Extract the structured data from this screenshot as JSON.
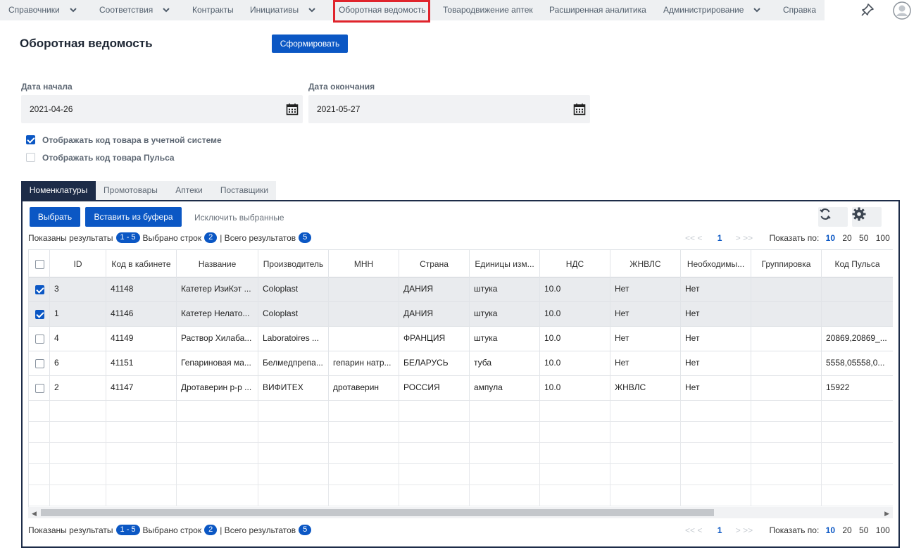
{
  "nav": {
    "items": [
      {
        "label": "Справочники",
        "dropdown": true
      },
      {
        "label": "Соответствия",
        "dropdown": true
      },
      {
        "label": "Контракты",
        "dropdown": false
      },
      {
        "label": "Инициативы",
        "dropdown": true
      },
      {
        "label": "Оборотная ведомость",
        "dropdown": false,
        "active": true
      },
      {
        "label": "Товародвижение аптек",
        "dropdown": false
      },
      {
        "label": "Расширенная аналитика",
        "dropdown": false
      },
      {
        "label": "Администрирование",
        "dropdown": true
      },
      {
        "label": "Справка",
        "dropdown": false
      }
    ],
    "icons": [
      "pin-icon",
      "user-avatar-icon"
    ]
  },
  "page": {
    "title": "Оборотная ведомость",
    "generate_label": "Сформировать"
  },
  "filters": {
    "start_label": "Дата начала",
    "start_value": "2021-04-26",
    "end_label": "Дата окончания",
    "end_value": "2021-05-27",
    "show_account_code": {
      "label": "Отображать код товара в учетной системе",
      "checked": true
    },
    "show_pulse_code": {
      "label": "Отображать код товара Пульса",
      "checked": false
    }
  },
  "tabs": [
    "Номенклатуры",
    "Промотовары",
    "Аптеки",
    "Поставщики"
  ],
  "toolbar": {
    "select_label": "Выбрать",
    "paste_label": "Вставить из буфера",
    "exclude_label": "Исключить выбранные",
    "icons": [
      "refresh-icon",
      "settings-gear-icon"
    ]
  },
  "summary": {
    "shown_label": "Показаны результаты",
    "shown_range": "1 - 5",
    "selected_label": "Выбрано строк",
    "selected_count": "2",
    "total_label": "| Всего результатов",
    "total_count": "5"
  },
  "pager": {
    "prev": "<< <",
    "page": "1",
    "next": "> >>",
    "page_size_label": "Показать по:",
    "sizes": [
      "10",
      "20",
      "50",
      "100"
    ],
    "active_size": "10"
  },
  "table": {
    "columns": [
      "ID",
      "Код в кабинете",
      "Название",
      "Производитель",
      "МНН",
      "Страна",
      "Единицы изм...",
      "НДС",
      "ЖНВЛС",
      "Необходимы...",
      "Группировка",
      "Код Пульса"
    ],
    "rows": [
      {
        "selected": true,
        "cells": [
          "3",
          "41148",
          "Катетер ИзиКэт ...",
          "Coloplast",
          "",
          "ДАНИЯ",
          "штука",
          "10.0",
          "Нет",
          "Нет",
          "",
          ""
        ]
      },
      {
        "selected": true,
        "cells": [
          "1",
          "41146",
          "Катетер Нелато...",
          "Coloplast",
          "",
          "ДАНИЯ",
          "штука",
          "10.0",
          "Нет",
          "Нет",
          "",
          ""
        ]
      },
      {
        "selected": false,
        "cells": [
          "4",
          "41149",
          "Раствор Хилаба...",
          "Laboratoires ...",
          "",
          "ФРАНЦИЯ",
          "штука",
          "10.0",
          "Нет",
          "Нет",
          "",
          "20869,20869_..."
        ]
      },
      {
        "selected": false,
        "cells": [
          "6",
          "41151",
          "Гепариновая ма...",
          "Белмедпрепа...",
          "гепарин натр...",
          "БЕЛАРУСЬ",
          "туба",
          "10.0",
          "Нет",
          "Нет",
          "",
          "5558,05558,0..."
        ]
      },
      {
        "selected": false,
        "cells": [
          "2",
          "41147",
          "Дротаверин р-р ...",
          "ВИФИТЕХ",
          "дротаверин",
          "РОССИЯ",
          "ампула",
          "10.0",
          "ЖНВЛС",
          "Нет",
          "",
          "15922"
        ]
      }
    ],
    "empty_rows": 5
  }
}
